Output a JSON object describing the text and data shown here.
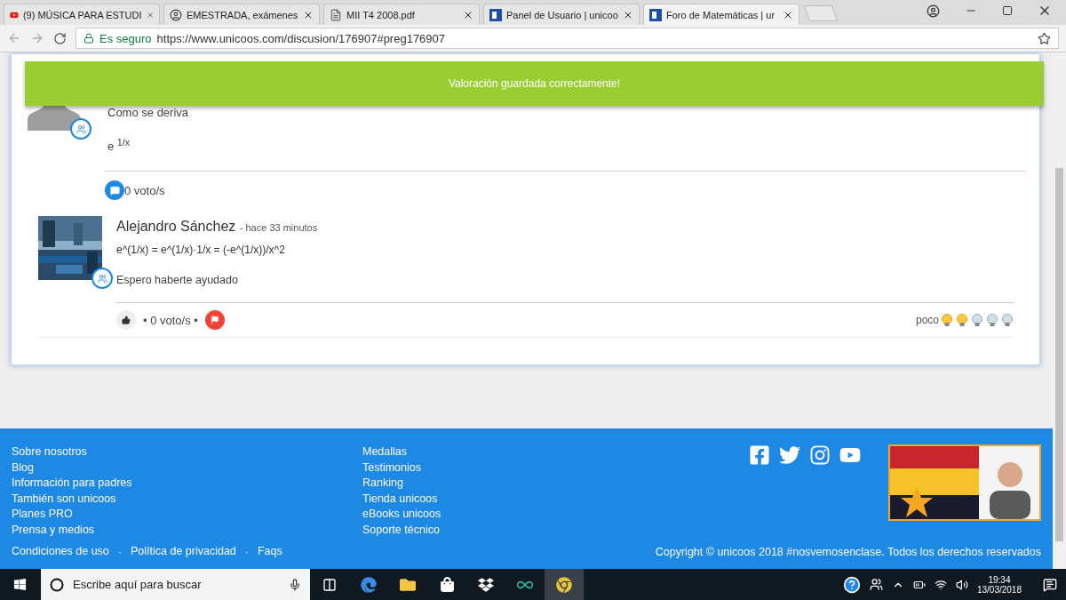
{
  "browser": {
    "tabs": [
      {
        "title": "(9) MÚSICA PARA ESTUDI",
        "kind": "video",
        "selected": false
      },
      {
        "title": "EMESTRADA, exámenes",
        "kind": "site",
        "selected": false
      },
      {
        "title": "MII T4 2008.pdf",
        "kind": "document",
        "selected": false
      },
      {
        "title": "Panel de Usuario | unicoo",
        "kind": "forum",
        "selected": false
      },
      {
        "title": "Foro de Matemáticas | ur",
        "kind": "forum",
        "selected": true
      }
    ],
    "security": "Es seguro",
    "url": "https://www.unicoos.com/discusion/176907#preg176907"
  },
  "notification": "Valoración guardada correctamente!",
  "question": {
    "title": "Como se deriva",
    "formula": "e $^{1/x}$",
    "votes": "0 voto/s"
  },
  "answer": {
    "author": "Alejandro Sánchez",
    "time": "- hace 33 minutos",
    "lines": [
      "e^(1/x) = e^(1/x)·1/x = (-e^(1/x))/x^2",
      "Espero haberte ayudado"
    ],
    "votes": "• 0 voto/s •",
    "rating_label": "poco",
    "stars": 2
  },
  "footer": {
    "links_1": [
      "Sobre nosotros",
      "Blog",
      "Información para padres",
      "También son unicoos",
      "Planes PRO",
      "Prensa y medios"
    ],
    "links_2": [
      "Medallas",
      "Testimonios",
      "Ranking",
      "Tienda unicoos",
      "eBooks unicoos",
      "Soporte técnico"
    ],
    "bottom_links": [
      "Condiciones de uso",
      "Política de privacidad",
      "Faqs"
    ],
    "separator": "·",
    "copyright": "Copyright © unicoos 2018 #nosvemosenclase. Todos los derechos reservados"
  },
  "taskbar": {
    "search_placeholder": "Escribe aquí para buscar",
    "time": "19:34",
    "date": "13/03/2018"
  }
}
